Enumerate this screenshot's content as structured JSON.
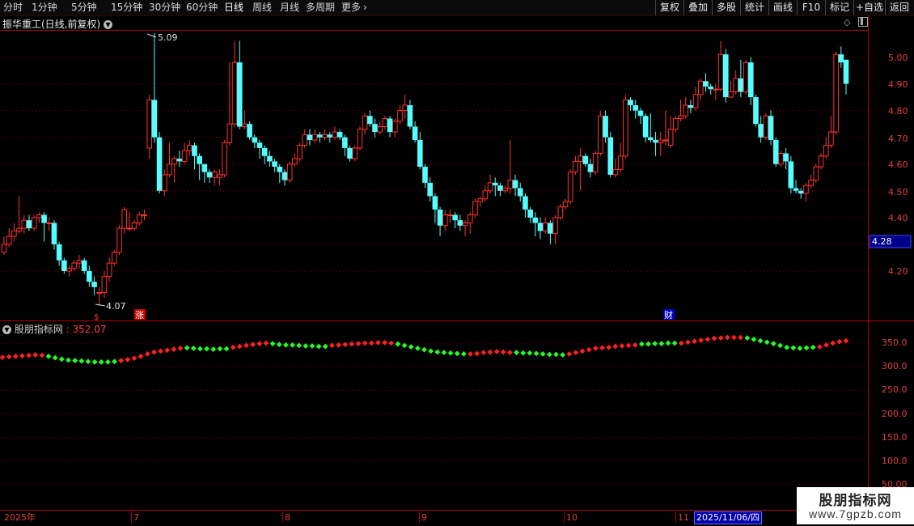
{
  "toolbar": {
    "periods": [
      "分时",
      "1分钟",
      "5分钟",
      "15分钟",
      "30分钟",
      "60分钟",
      "日线",
      "周线",
      "月线",
      "多周期",
      "更多"
    ],
    "active_period": "日线",
    "more_arrow": "›",
    "right_buttons": [
      "复权",
      "叠加",
      "多股",
      "统计",
      "画线",
      "F10",
      "标记",
      "+自选",
      "返回"
    ]
  },
  "stock": {
    "title": "振华重工(日线,前复权)"
  },
  "indicator": {
    "name": "股朋指标网",
    "value": "352.07"
  },
  "price_axis": {
    "ticks": [
      "5.00",
      "4.90",
      "4.80",
      "4.70",
      "4.60",
      "4.50",
      "4.40",
      "4.20"
    ],
    "current": "4.28",
    "current_color": "#1a1aff"
  },
  "indicator_axis": {
    "ticks": [
      "350.0",
      "300.0",
      "250.0",
      "200.0",
      "150.0",
      "100.0",
      "50.00"
    ]
  },
  "annotations": {
    "high": "5.09",
    "low": "4.07",
    "rise_badge": "涨",
    "finance_badge": "财",
    "dollar_mark": "$"
  },
  "time_axis": {
    "labels": [
      "2025年",
      "7",
      "8",
      "9",
      "10",
      "11"
    ],
    "cursor_date": "2025/11/06/四"
  },
  "watermark": {
    "line1": "股朋指标网",
    "line2": "www.7gpzb.com"
  },
  "colors": {
    "up": "#ff3232",
    "down": "#54ffff",
    "indicator_up": "#ff2020",
    "indicator_down": "#22ff22",
    "grid": "#7a0000",
    "border": "#b00000"
  },
  "candles": [
    [
      4.27,
      4.3,
      4.33,
      4.26
    ],
    [
      4.3,
      4.33,
      4.36,
      4.29
    ],
    [
      4.33,
      4.35,
      4.38,
      4.31
    ],
    [
      4.35,
      4.36,
      4.48,
      4.34
    ],
    [
      4.36,
      4.39,
      4.41,
      4.34
    ],
    [
      4.39,
      4.36,
      4.41,
      4.35
    ],
    [
      4.36,
      4.4,
      4.41,
      4.35
    ],
    [
      4.4,
      4.41,
      4.42,
      4.38
    ],
    [
      4.41,
      4.38,
      4.42,
      4.31
    ],
    [
      4.38,
      4.38,
      4.4,
      4.35
    ],
    [
      4.38,
      4.3,
      4.39,
      4.28
    ],
    [
      4.3,
      4.24,
      4.31,
      4.22
    ],
    [
      4.24,
      4.2,
      4.25,
      4.19
    ],
    [
      4.2,
      4.21,
      4.22,
      4.18
    ],
    [
      4.21,
      4.23,
      4.24,
      4.2
    ],
    [
      4.23,
      4.24,
      4.26,
      4.21
    ],
    [
      4.24,
      4.2,
      4.25,
      4.19
    ],
    [
      4.2,
      4.16,
      4.22,
      4.14
    ],
    [
      4.16,
      4.14,
      4.18,
      4.11
    ],
    [
      4.12,
      4.12,
      4.14,
      4.07
    ],
    [
      4.12,
      4.18,
      4.2,
      4.1
    ],
    [
      4.18,
      4.23,
      4.25,
      4.16
    ],
    [
      4.23,
      4.27,
      4.28,
      4.22
    ],
    [
      4.27,
      4.36,
      4.37,
      4.26
    ],
    [
      4.36,
      4.43,
      4.44,
      4.34
    ],
    [
      4.36,
      4.36,
      4.42,
      4.35
    ],
    [
      4.36,
      4.38,
      4.39,
      4.35
    ],
    [
      4.38,
      4.41,
      4.42,
      4.37
    ],
    [
      4.41,
      4.41,
      4.43,
      4.39
    ],
    [
      4.66,
      4.84,
      4.86,
      4.62
    ],
    [
      4.84,
      4.7,
      5.09,
      4.68
    ],
    [
      4.7,
      4.5,
      4.72,
      4.49
    ],
    [
      4.5,
      4.56,
      4.58,
      4.48
    ],
    [
      4.56,
      4.6,
      4.68,
      4.55
    ],
    [
      4.6,
      4.62,
      4.63,
      4.53
    ],
    [
      4.62,
      4.61,
      4.65,
      4.59
    ],
    [
      4.61,
      4.65,
      4.68,
      4.6
    ],
    [
      4.65,
      4.67,
      4.69,
      4.63
    ],
    [
      4.67,
      4.63,
      4.68,
      4.58
    ],
    [
      4.63,
      4.6,
      4.64,
      4.54
    ],
    [
      4.6,
      4.57,
      4.6,
      4.53
    ],
    [
      4.57,
      4.55,
      4.58,
      4.53
    ],
    [
      4.55,
      4.57,
      4.58,
      4.52
    ],
    [
      4.55,
      4.56,
      4.58,
      4.52
    ],
    [
      4.56,
      4.68,
      4.69,
      4.55
    ],
    [
      4.68,
      4.75,
      4.98,
      4.67
    ],
    [
      4.75,
      4.98,
      5.06,
      4.74
    ],
    [
      4.98,
      4.74,
      5.06,
      4.73
    ],
    [
      4.74,
      4.75,
      4.8,
      4.73
    ],
    [
      4.75,
      4.7,
      4.76,
      4.69
    ],
    [
      4.7,
      4.68,
      4.71,
      4.66
    ],
    [
      4.68,
      4.66,
      4.69,
      4.62
    ],
    [
      4.66,
      4.63,
      4.67,
      4.6
    ],
    [
      4.63,
      4.61,
      4.65,
      4.59
    ],
    [
      4.61,
      4.59,
      4.62,
      4.57
    ],
    [
      4.59,
      4.57,
      4.6,
      4.53
    ],
    [
      4.57,
      4.54,
      4.58,
      4.52
    ],
    [
      4.54,
      4.6,
      4.61,
      4.53
    ],
    [
      4.6,
      4.62,
      4.64,
      4.59
    ],
    [
      4.62,
      4.67,
      4.68,
      4.61
    ],
    [
      4.67,
      4.71,
      4.73,
      4.66
    ],
    [
      4.71,
      4.69,
      4.73,
      4.67
    ],
    [
      4.69,
      4.71,
      4.73,
      4.68
    ],
    [
      4.71,
      4.7,
      4.72,
      4.68
    ],
    [
      4.7,
      4.71,
      4.73,
      4.69
    ],
    [
      4.71,
      4.7,
      4.72,
      4.68
    ],
    [
      4.7,
      4.72,
      4.74,
      4.69
    ],
    [
      4.72,
      4.7,
      4.73,
      4.69
    ],
    [
      4.7,
      4.66,
      4.71,
      4.63
    ],
    [
      4.66,
      4.62,
      4.67,
      4.61
    ],
    [
      4.62,
      4.66,
      4.67,
      4.61
    ],
    [
      4.66,
      4.73,
      4.74,
      4.65
    ],
    [
      4.73,
      4.78,
      4.79,
      4.71
    ],
    [
      4.78,
      4.75,
      4.8,
      4.74
    ],
    [
      4.75,
      4.72,
      4.77,
      4.7
    ],
    [
      4.72,
      4.74,
      4.76,
      4.71
    ],
    [
      4.74,
      4.77,
      4.78,
      4.73
    ],
    [
      4.77,
      4.72,
      4.78,
      4.7
    ],
    [
      4.72,
      4.76,
      4.77,
      4.7
    ],
    [
      4.76,
      4.8,
      4.82,
      4.75
    ],
    [
      4.8,
      4.82,
      4.86,
      4.77
    ],
    [
      4.82,
      4.74,
      4.84,
      4.73
    ],
    [
      4.74,
      4.69,
      4.76,
      4.68
    ],
    [
      4.69,
      4.59,
      4.72,
      4.58
    ],
    [
      4.59,
      4.53,
      4.6,
      4.51
    ],
    [
      4.53,
      4.48,
      4.55,
      4.46
    ],
    [
      4.48,
      4.43,
      4.49,
      4.38
    ],
    [
      4.43,
      4.37,
      4.44,
      4.33
    ],
    [
      4.37,
      4.41,
      4.43,
      4.35
    ],
    [
      4.41,
      4.41,
      4.43,
      4.38
    ],
    [
      4.41,
      4.39,
      4.42,
      4.36
    ],
    [
      4.39,
      4.37,
      4.41,
      4.35
    ],
    [
      4.37,
      4.38,
      4.39,
      4.33
    ],
    [
      4.38,
      4.41,
      4.42,
      4.34
    ],
    [
      4.41,
      4.46,
      4.47,
      4.4
    ],
    [
      4.46,
      4.47,
      4.48,
      4.44
    ],
    [
      4.47,
      4.5,
      4.52,
      4.46
    ],
    [
      4.5,
      4.53,
      4.56,
      4.49
    ],
    [
      4.53,
      4.52,
      4.55,
      4.48
    ],
    [
      4.52,
      4.5,
      4.53,
      4.48
    ],
    [
      4.5,
      4.51,
      4.52,
      4.49
    ],
    [
      4.51,
      4.54,
      4.69,
      4.49
    ],
    [
      4.54,
      4.51,
      4.56,
      4.48
    ],
    [
      4.51,
      4.48,
      4.53,
      4.46
    ],
    [
      4.48,
      4.43,
      4.49,
      4.4
    ],
    [
      4.43,
      4.4,
      4.44,
      4.38
    ],
    [
      4.4,
      4.38,
      4.42,
      4.33
    ],
    [
      4.38,
      4.35,
      4.4,
      4.32
    ],
    [
      4.35,
      4.38,
      4.4,
      4.34
    ],
    [
      4.38,
      4.34,
      4.39,
      4.3
    ],
    [
      4.34,
      4.4,
      4.41,
      4.3
    ],
    [
      4.4,
      4.44,
      4.45,
      4.39
    ],
    [
      4.44,
      4.46,
      4.47,
      4.43
    ],
    [
      4.46,
      4.57,
      4.58,
      4.45
    ],
    [
      4.57,
      4.61,
      4.63,
      4.56
    ],
    [
      4.61,
      4.63,
      4.66,
      4.5
    ],
    [
      4.63,
      4.6,
      4.64,
      4.59
    ],
    [
      4.6,
      4.57,
      4.62,
      4.55
    ],
    [
      4.57,
      4.64,
      4.65,
      4.56
    ],
    [
      4.64,
      4.78,
      4.8,
      4.63
    ],
    [
      4.78,
      4.7,
      4.8,
      4.68
    ],
    [
      4.7,
      4.56,
      4.72,
      4.55
    ],
    [
      4.56,
      4.58,
      4.62,
      4.55
    ],
    [
      4.58,
      4.63,
      4.68,
      4.57
    ],
    [
      4.63,
      4.84,
      4.86,
      4.62
    ],
    [
      4.84,
      4.82,
      4.85,
      4.8
    ],
    [
      4.82,
      4.8,
      4.84,
      4.77
    ],
    [
      4.8,
      4.78,
      4.81,
      4.75
    ],
    [
      4.78,
      4.7,
      4.79,
      4.68
    ],
    [
      4.7,
      4.69,
      4.79,
      4.68
    ],
    [
      4.69,
      4.68,
      4.72,
      4.63
    ],
    [
      4.68,
      4.69,
      4.72,
      4.63
    ],
    [
      4.69,
      4.69,
      4.8,
      4.67
    ],
    [
      4.67,
      4.73,
      4.78,
      4.66
    ],
    [
      4.73,
      4.77,
      4.78,
      4.72
    ],
    [
      4.77,
      4.78,
      4.84,
      4.76
    ],
    [
      4.78,
      4.82,
      4.85,
      4.77
    ],
    [
      4.82,
      4.81,
      4.84,
      4.79
    ],
    [
      4.81,
      4.86,
      4.89,
      4.8
    ],
    [
      4.86,
      4.91,
      4.92,
      4.84
    ],
    [
      4.91,
      4.89,
      4.94,
      4.87
    ],
    [
      4.89,
      4.88,
      4.9,
      4.86
    ],
    [
      4.88,
      4.88,
      4.9,
      4.84
    ],
    [
      4.88,
      5.01,
      5.06,
      4.87
    ],
    [
      5.01,
      4.85,
      5.03,
      4.83
    ],
    [
      4.85,
      4.87,
      4.91,
      4.85
    ],
    [
      4.87,
      4.92,
      4.95,
      4.86
    ],
    [
      4.92,
      4.87,
      4.99,
      4.85
    ],
    [
      4.87,
      4.98,
      4.99,
      4.86
    ],
    [
      4.98,
      4.85,
      5.0,
      4.82
    ],
    [
      4.85,
      4.75,
      4.86,
      4.74
    ],
    [
      4.75,
      4.7,
      4.78,
      4.68
    ],
    [
      4.7,
      4.78,
      4.79,
      4.69
    ],
    [
      4.78,
      4.69,
      4.8,
      4.67
    ],
    [
      4.69,
      4.6,
      4.7,
      4.59
    ],
    [
      4.6,
      4.64,
      4.65,
      4.59
    ],
    [
      4.64,
      4.61,
      4.66,
      4.58
    ],
    [
      4.61,
      4.51,
      4.63,
      4.49
    ],
    [
      4.51,
      4.5,
      4.54,
      4.49
    ],
    [
      4.5,
      4.49,
      4.51,
      4.47
    ],
    [
      4.49,
      4.52,
      4.53,
      4.46
    ],
    [
      4.52,
      4.54,
      4.56,
      4.51
    ],
    [
      4.54,
      4.59,
      4.6,
      4.53
    ],
    [
      4.59,
      4.63,
      4.64,
      4.58
    ],
    [
      4.63,
      4.67,
      4.7,
      4.62
    ],
    [
      4.67,
      4.72,
      4.78,
      4.66
    ],
    [
      4.72,
      5.01,
      5.02,
      4.71
    ],
    [
      5.01,
      4.98,
      5.04,
      4.96
    ],
    [
      4.99,
      4.9,
      4.99,
      4.86
    ]
  ],
  "indicator_series": [
    {
      "v": [
        320,
        321,
        322,
        323,
        324,
        325,
        324
      ],
      "up": true
    },
    {
      "v": [
        322,
        319,
        316,
        314,
        313,
        312,
        311,
        310,
        310,
        310,
        311
      ],
      "up": false
    },
    {
      "v": [
        313,
        315,
        318,
        322,
        327,
        331,
        333,
        335,
        337,
        339
      ],
      "up": true
    },
    {
      "v": [
        340,
        339,
        338,
        338,
        337,
        338,
        338
      ],
      "up": false
    },
    {
      "v": [
        341,
        343,
        345,
        347,
        349,
        350
      ],
      "up": true
    },
    {
      "v": [
        349,
        347,
        346,
        346,
        345,
        344,
        344,
        343,
        343
      ],
      "up": false
    },
    {
      "v": [
        345,
        346,
        347,
        348,
        349,
        350,
        350,
        351,
        351,
        350
      ],
      "up": true
    },
    {
      "v": [
        348,
        345,
        342,
        339,
        336,
        333,
        331,
        330,
        329,
        328,
        327
      ],
      "up": false
    },
    {
      "v": [
        327,
        328,
        330,
        331,
        332,
        331,
        330
      ],
      "up": true
    },
    {
      "v": [
        330,
        329,
        329,
        328,
        327,
        326,
        326,
        325
      ],
      "up": false
    },
    {
      "v": [
        327,
        330,
        333,
        336,
        339,
        340,
        341,
        343,
        344,
        345,
        346
      ],
      "up": true
    },
    {
      "v": [
        348,
        348,
        349,
        349,
        350,
        350
      ],
      "up": false
    },
    {
      "v": [
        350,
        352,
        354,
        356,
        358,
        360,
        361,
        362,
        362,
        362
      ],
      "up": true
    },
    {
      "v": [
        361,
        358,
        355,
        352,
        349,
        345,
        341,
        340,
        339,
        340,
        341
      ],
      "up": false
    },
    {
      "v": [
        342,
        346,
        350,
        353,
        355
      ],
      "up": true
    }
  ]
}
